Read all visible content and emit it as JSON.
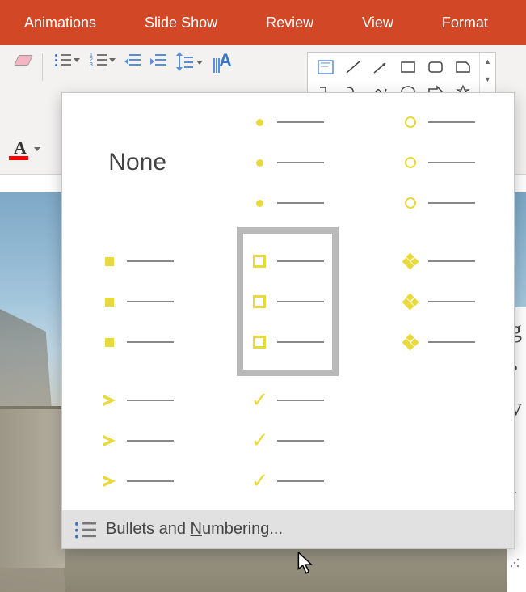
{
  "ribbon": {
    "tabs": [
      "Animations",
      "Slide Show",
      "Review",
      "View",
      "Format"
    ]
  },
  "bullets_dropdown": {
    "none_label": "None",
    "options": [
      {
        "id": "none",
        "label": "None"
      },
      {
        "id": "filled-circle"
      },
      {
        "id": "hollow-circle"
      },
      {
        "id": "filled-square"
      },
      {
        "id": "hollow-square",
        "selected": true
      },
      {
        "id": "four-diamonds"
      },
      {
        "id": "arrow"
      },
      {
        "id": "checkmark"
      }
    ],
    "footer_prefix": "Bullets and ",
    "footer_underlined": "N",
    "footer_suffix": "umbering..."
  },
  "colors": {
    "ribbon_bg": "#d24726",
    "bullet_marker": "#e8d93c",
    "font_color_swatch": "#ff0000"
  }
}
